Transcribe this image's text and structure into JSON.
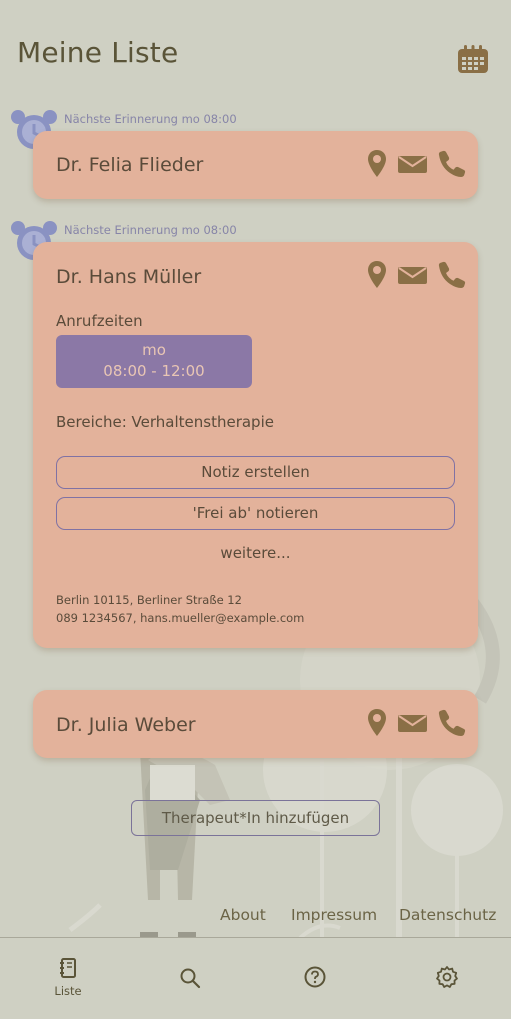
{
  "header": {
    "title": "Meine Liste",
    "calendar_icon": "calendar-icon"
  },
  "colors": {
    "background": "#cfd0c3",
    "card": "#e3b29b",
    "accent_purple": "#8b78a6",
    "icon_brown": "#8a6f46",
    "text_dark": "#5a4b3a"
  },
  "therapists": [
    {
      "reminder": "Nächste Erinnerung mo 08:00",
      "name": "Dr. Felia Flieder",
      "expanded": false
    },
    {
      "reminder": "Nächste Erinnerung mo 08:00",
      "name": "Dr. Hans Müller",
      "expanded": true,
      "call_times_label": "Anrufzeiten",
      "call_times": [
        {
          "day": "mo",
          "time": "08:00 - 12:00"
        }
      ],
      "areas": "Bereiche: Verhaltenstherapie",
      "note_button": "Notiz erstellen",
      "free_button": "'Frei ab' notieren",
      "more_link": "weitere...",
      "address": "Berlin 10115, Berliner Straße 12",
      "contact": "089 1234567, hans.mueller@example.com"
    },
    {
      "name": "Dr. Julia Weber",
      "expanded": false
    }
  ],
  "add_button": "Therapeut*In hinzufügen",
  "footer_links": [
    "About",
    "Impressum",
    "Datenschutz"
  ],
  "nav": {
    "items": [
      {
        "icon": "notebook-icon",
        "label": "Liste",
        "active": true
      },
      {
        "icon": "search-icon",
        "label": ""
      },
      {
        "icon": "help-icon",
        "label": ""
      },
      {
        "icon": "settings-icon",
        "label": ""
      }
    ]
  }
}
